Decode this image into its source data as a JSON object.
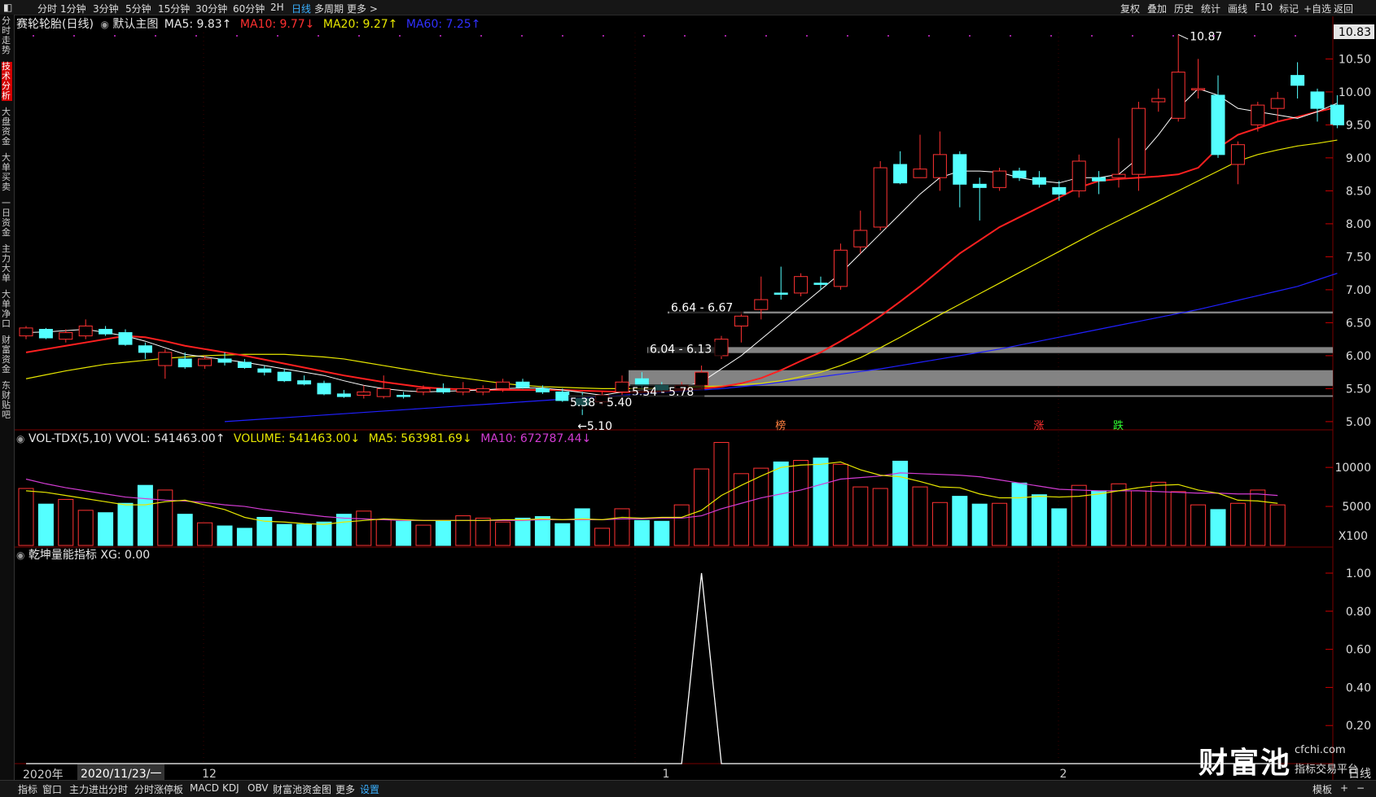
{
  "topbar": {
    "tabs": [
      "分时",
      "1分钟",
      "3分钟",
      "5分钟",
      "15分钟",
      "30分钟",
      "60分钟",
      "2H",
      "日线",
      "多周期",
      "更多 >"
    ],
    "active_tab": "日线",
    "right_tools": [
      "复权",
      "叠加",
      "历史",
      "统计",
      "画线",
      "F10",
      "标记",
      "+自选",
      "返回"
    ]
  },
  "sidebar": {
    "items": [
      "分时走势",
      "技术分析",
      "大盘资金",
      "大单买卖",
      "一日资金",
      "主力大单",
      "大单净口",
      "财富资金",
      "东财贴吧"
    ],
    "active": "技术分析"
  },
  "main_legend": {
    "name": "赛轮轮胎(日线)",
    "template": "默认主图",
    "ma5": "MA5: 9.83↑",
    "ma10": "MA10: 9.77↓",
    "ma20": "MA20: 9.27↑",
    "ma60": "MA60: 7.25↑"
  },
  "vol_legend": {
    "name": "VOL-TDX(5,10)",
    "vvol": "VVOL: 541463.00↑",
    "volume": "VOLUME: 541463.00↓",
    "ma5": "MA5: 563981.69↓",
    "ma10": "MA10: 672787.44↓"
  },
  "ind_legend": {
    "name": "乾坤量能指标",
    "xg": "XG: 0.00"
  },
  "annotations": {
    "high": "10.87",
    "low": "5.10",
    "zones": [
      "6.64 - 6.67",
      "6.04 - 6.13",
      "5.54 - 5.78",
      "5.38 - 5.40"
    ],
    "markers": [
      {
        "text": "榜",
        "color": "#ff8040",
        "day": 38
      },
      {
        "text": "涨",
        "color": "#ff3030",
        "day": 51
      },
      {
        "text": "跌",
        "color": "#30ff30",
        "day": 55
      }
    ]
  },
  "price_axis": {
    "top_label": "10.83",
    "ticks": [
      "10.50",
      "10.00",
      "9.50",
      "9.00",
      "8.50",
      "8.00",
      "7.50",
      "7.00",
      "6.50",
      "6.00",
      "5.50",
      "5.00"
    ]
  },
  "vol_axis": {
    "ticks": [
      "10000",
      "5000"
    ],
    "unit": "X100"
  },
  "ind_axis": {
    "ticks": [
      "1.00",
      "0.80",
      "0.60",
      "0.40",
      "0.20"
    ]
  },
  "date_axis": {
    "year": "2020年",
    "cursor_date": "2020/11/23/一",
    "months": [
      "12",
      "1",
      "2"
    ]
  },
  "watermark": {
    "brand": "财富池",
    "site": "cfchi.com",
    "slogan": "指标交易平台"
  },
  "bottombar": {
    "left": [
      "指标",
      "窗口",
      "主力进出分时",
      "分时涨停板",
      "MACD",
      "KDJ",
      "OBV",
      "财富池资金图",
      "更多",
      "设置"
    ],
    "right": [
      "模板",
      "+",
      "−"
    ],
    "period": "日线"
  },
  "colors": {
    "up": "#ff3232",
    "down": "#54ffff",
    "ma5": "#ffffff",
    "ma10": "#ff2020",
    "ma20": "#e6e600",
    "ma60": "#2020ff",
    "vma10": "#d23cd2"
  },
  "chart_data": {
    "type": "candlestick",
    "title": "赛轮轮胎(日线)",
    "ylim": [
      4.9,
      10.9
    ],
    "ohlc": [
      [
        6.3,
        6.45,
        6.25,
        6.42
      ],
      [
        6.4,
        6.42,
        6.25,
        6.27
      ],
      [
        6.25,
        6.4,
        6.2,
        6.35
      ],
      [
        6.3,
        6.55,
        6.25,
        6.45
      ],
      [
        6.4,
        6.45,
        6.3,
        6.33
      ],
      [
        6.35,
        6.4,
        6.15,
        6.17
      ],
      [
        6.15,
        6.2,
        5.95,
        6.05
      ],
      [
        5.85,
        6.1,
        5.65,
        6.05
      ],
      [
        5.95,
        6.05,
        5.8,
        5.83
      ],
      [
        5.85,
        6.0,
        5.8,
        5.95
      ],
      [
        5.95,
        6.05,
        5.85,
        5.9
      ],
      [
        5.9,
        5.95,
        5.8,
        5.82
      ],
      [
        5.8,
        5.85,
        5.7,
        5.75
      ],
      [
        5.75,
        5.8,
        5.6,
        5.62
      ],
      [
        5.62,
        5.7,
        5.55,
        5.57
      ],
      [
        5.58,
        5.62,
        5.4,
        5.42
      ],
      [
        5.42,
        5.48,
        5.36,
        5.38
      ],
      [
        5.4,
        5.55,
        5.35,
        5.45
      ],
      [
        5.38,
        5.7,
        5.35,
        5.5
      ],
      [
        5.4,
        5.45,
        5.35,
        5.38
      ],
      [
        5.45,
        5.55,
        5.4,
        5.5
      ],
      [
        5.5,
        5.58,
        5.42,
        5.45
      ],
      [
        5.45,
        5.6,
        5.4,
        5.5
      ],
      [
        5.45,
        5.55,
        5.4,
        5.5
      ],
      [
        5.5,
        5.65,
        5.45,
        5.6
      ],
      [
        5.6,
        5.65,
        5.5,
        5.52
      ],
      [
        5.5,
        5.55,
        5.42,
        5.45
      ],
      [
        5.45,
        5.5,
        5.3,
        5.32
      ],
      [
        5.35,
        5.45,
        5.1,
        5.25
      ],
      [
        5.3,
        5.45,
        5.25,
        5.4
      ],
      [
        5.45,
        5.7,
        5.4,
        5.6
      ],
      [
        5.65,
        5.75,
        5.5,
        5.55
      ],
      [
        5.55,
        5.6,
        5.45,
        5.48
      ],
      [
        5.5,
        5.6,
        5.45,
        5.55
      ],
      [
        5.55,
        5.85,
        5.5,
        5.75
      ],
      [
        6.0,
        6.3,
        5.95,
        6.25
      ],
      [
        6.45,
        6.67,
        6.2,
        6.6
      ],
      [
        6.7,
        7.2,
        6.55,
        6.85
      ],
      [
        6.95,
        7.35,
        6.85,
        6.93
      ],
      [
        6.95,
        7.25,
        6.9,
        7.2
      ],
      [
        7.1,
        7.2,
        7.0,
        7.08
      ],
      [
        7.05,
        7.7,
        7.0,
        7.6
      ],
      [
        7.65,
        8.2,
        7.55,
        7.9
      ],
      [
        7.95,
        8.95,
        7.9,
        8.85
      ],
      [
        8.9,
        9.1,
        8.6,
        8.62
      ],
      [
        8.7,
        9.35,
        8.7,
        8.83
      ],
      [
        8.7,
        9.4,
        8.5,
        9.05
      ],
      [
        9.05,
        9.1,
        8.25,
        8.6
      ],
      [
        8.6,
        8.7,
        8.05,
        8.55
      ],
      [
        8.55,
        8.85,
        8.5,
        8.8
      ],
      [
        8.8,
        8.85,
        8.65,
        8.7
      ],
      [
        8.7,
        8.8,
        8.55,
        8.6
      ],
      [
        8.55,
        8.65,
        8.35,
        8.45
      ],
      [
        8.5,
        9.05,
        8.4,
        8.95
      ],
      [
        8.7,
        8.8,
        8.45,
        8.65
      ],
      [
        8.7,
        9.3,
        8.55,
        8.75
      ],
      [
        8.75,
        9.85,
        8.5,
        9.75
      ],
      [
        9.85,
        10.05,
        9.7,
        9.9
      ],
      [
        9.6,
        10.87,
        9.55,
        10.3
      ],
      [
        10.05,
        10.5,
        9.9,
        10.05
      ],
      [
        9.95,
        10.25,
        9.0,
        9.05
      ],
      [
        8.9,
        9.25,
        8.6,
        9.2
      ],
      [
        9.5,
        9.85,
        9.4,
        9.8
      ],
      [
        9.75,
        10.0,
        9.55,
        9.9
      ],
      [
        10.25,
        10.45,
        9.9,
        10.1
      ],
      [
        10.0,
        10.05,
        9.55,
        9.75
      ],
      [
        9.8,
        9.95,
        9.45,
        9.5
      ]
    ],
    "ma5": [
      6.35,
      6.36,
      6.38,
      6.4,
      6.35,
      6.3,
      6.22,
      6.12,
      6.02,
      5.98,
      5.94,
      5.9,
      5.85,
      5.8,
      5.75,
      5.7,
      5.62,
      5.55,
      5.5,
      5.47,
      5.45,
      5.46,
      5.47,
      5.48,
      5.5,
      5.51,
      5.51,
      5.48,
      5.44,
      5.4,
      5.45,
      5.48,
      5.5,
      5.52,
      5.6,
      5.8,
      6.0,
      6.25,
      6.5,
      6.75,
      7.0,
      7.25,
      7.55,
      7.85,
      8.15,
      8.45,
      8.7,
      8.8,
      8.8,
      8.78,
      8.7,
      8.65,
      8.62,
      8.7,
      8.7,
      8.75,
      9.0,
      9.35,
      9.75,
      10.05,
      9.95,
      9.75,
      9.7,
      9.65,
      9.6,
      9.7,
      9.83
    ],
    "ma10": [
      6.05,
      6.1,
      6.15,
      6.2,
      6.25,
      6.3,
      6.28,
      6.22,
      6.15,
      6.1,
      6.05,
      6.0,
      5.94,
      5.88,
      5.82,
      5.76,
      5.7,
      5.65,
      5.6,
      5.56,
      5.52,
      5.5,
      5.49,
      5.48,
      5.48,
      5.48,
      5.48,
      5.48,
      5.47,
      5.46,
      5.45,
      5.45,
      5.46,
      5.48,
      5.5,
      5.53,
      5.58,
      5.66,
      5.78,
      5.92,
      6.05,
      6.22,
      6.4,
      6.6,
      6.82,
      7.05,
      7.3,
      7.55,
      7.75,
      7.95,
      8.1,
      8.25,
      8.4,
      8.55,
      8.65,
      8.68,
      8.7,
      8.72,
      8.75,
      8.85,
      9.15,
      9.35,
      9.45,
      9.55,
      9.62,
      9.7,
      9.77
    ],
    "ma20": [
      5.65,
      5.71,
      5.77,
      5.82,
      5.87,
      5.9,
      5.93,
      5.96,
      5.98,
      6.0,
      6.01,
      6.02,
      6.02,
      6.02,
      6.0,
      5.98,
      5.95,
      5.9,
      5.85,
      5.8,
      5.75,
      5.7,
      5.66,
      5.62,
      5.58,
      5.55,
      5.53,
      5.52,
      5.51,
      5.5,
      5.5,
      5.5,
      5.51,
      5.52,
      5.53,
      5.54,
      5.56,
      5.58,
      5.62,
      5.68,
      5.75,
      5.85,
      5.97,
      6.12,
      6.28,
      6.45,
      6.62,
      6.78,
      6.94,
      7.1,
      7.26,
      7.42,
      7.58,
      7.74,
      7.9,
      8.05,
      8.2,
      8.35,
      8.5,
      8.65,
      8.8,
      8.95,
      9.05,
      9.12,
      9.18,
      9.22,
      9.27
    ],
    "ma60": [
      null,
      null,
      null,
      null,
      null,
      null,
      null,
      null,
      null,
      null,
      5.0,
      5.02,
      5.04,
      5.06,
      5.08,
      5.1,
      5.12,
      5.14,
      5.16,
      5.18,
      5.2,
      5.22,
      5.24,
      5.26,
      5.28,
      5.3,
      5.32,
      5.34,
      5.36,
      5.38,
      5.4,
      5.42,
      5.44,
      5.46,
      5.48,
      5.5,
      5.53,
      5.56,
      5.6,
      5.64,
      5.68,
      5.72,
      5.76,
      5.8,
      5.85,
      5.9,
      5.95,
      6.0,
      6.05,
      6.1,
      6.16,
      6.22,
      6.28,
      6.34,
      6.4,
      6.46,
      6.52,
      6.58,
      6.64,
      6.7,
      6.77,
      6.84,
      6.91,
      6.98,
      7.05,
      7.15,
      7.25
    ],
    "volume": [
      7300,
      5300,
      5900,
      4500,
      4200,
      5400,
      7700,
      7100,
      4000,
      2900,
      2500,
      2200,
      3600,
      2700,
      2700,
      3000,
      4000,
      4400,
      3300,
      3100,
      2600,
      3100,
      3800,
      3500,
      3000,
      3500,
      3700,
      2800,
      4700,
      2200,
      4700,
      3200,
      3100,
      5200,
      9800,
      13200,
      9200,
      9900,
      10700,
      10900,
      11200,
      10400,
      7500,
      7300,
      10800,
      7500,
      5500,
      6300,
      5300,
      5400,
      8000,
      6500,
      4700,
      7700,
      7000,
      7900,
      7000,
      8100,
      6900,
      5200,
      4600,
      5400,
      7100,
      5200
    ],
    "vma5": [
      7000,
      6800,
      6400,
      6000,
      5600,
      5200,
      5200,
      5600,
      5800,
      5200,
      4600,
      3600,
      3100,
      3000,
      2800,
      2700,
      3000,
      3200,
      3400,
      3300,
      3200,
      3200,
      3200,
      3200,
      3300,
      3300,
      3400,
      3300,
      3400,
      3300,
      3600,
      3500,
      3600,
      3600,
      4500,
      6400,
      7700,
      8900,
      10000,
      10300,
      10400,
      10700,
      9700,
      9000,
      8800,
      8200,
      7500,
      7400,
      6600,
      6100,
      6100,
      6300,
      6200,
      6300,
      6600,
      7000,
      7400,
      7700,
      7800,
      7100,
      6700,
      5800,
      5700,
      5400
    ],
    "vma10": [
      8500,
      7900,
      7400,
      7000,
      6600,
      6200,
      6000,
      5800,
      5700,
      5500,
      5200,
      5000,
      4600,
      4300,
      4000,
      3700,
      3500,
      3400,
      3300,
      3200,
      3200,
      3200,
      3200,
      3200,
      3200,
      3200,
      3300,
      3300,
      3300,
      3300,
      3400,
      3400,
      3500,
      3500,
      3800,
      4700,
      5400,
      6100,
      6600,
      7100,
      7800,
      8500,
      8700,
      8900,
      9300,
      9200,
      9100,
      9000,
      8800,
      8400,
      8000,
      7600,
      7200,
      7100,
      7000,
      7000,
      7000,
      6900,
      6800,
      6700,
      6700,
      6600,
      6600,
      6400
    ],
    "xg": [
      0,
      0,
      0,
      0,
      0,
      0,
      0,
      0,
      0,
      0,
      0,
      0,
      0,
      0,
      0,
      0,
      0,
      0,
      0,
      0,
      0,
      0,
      0,
      0,
      0,
      0,
      0,
      0,
      0,
      0,
      0,
      0,
      0,
      0,
      1,
      0,
      0,
      0,
      0,
      0,
      0,
      0,
      0,
      0,
      0,
      0,
      0,
      0,
      0,
      0,
      0,
      0,
      0,
      0,
      0,
      0,
      0,
      0,
      0,
      0,
      0,
      0,
      0,
      0
    ]
  }
}
